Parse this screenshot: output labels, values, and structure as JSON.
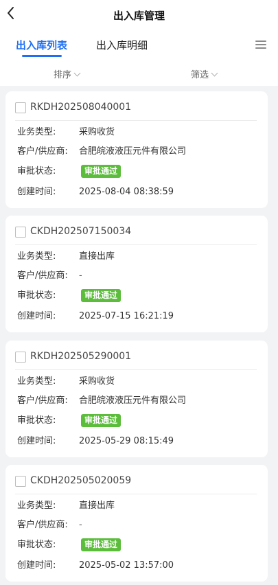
{
  "header": {
    "title": "出入库管理",
    "tabs": [
      {
        "label": "出入库列表",
        "active": true
      },
      {
        "label": "出入库明细",
        "active": false
      }
    ],
    "sort_label": "排序",
    "filter_label": "筛选"
  },
  "field_labels": {
    "business_type": "业务类型:",
    "customer_supplier": "客户/供应商:",
    "approval_status": "审批状态:",
    "created_time": "创建时间:"
  },
  "records": [
    {
      "order_no": "RKDH202508040001",
      "business_type": "采购收货",
      "customer_supplier": "合肥皖液液压元件有限公司",
      "approval_status": "审批通过",
      "created_time": "2025-08-04 08:38:59"
    },
    {
      "order_no": "CKDH202507150034",
      "business_type": "直接出库",
      "customer_supplier": "-",
      "approval_status": "审批通过",
      "created_time": "2025-07-15 16:21:19"
    },
    {
      "order_no": "RKDH202505290001",
      "business_type": "采购收货",
      "customer_supplier": "合肥皖液液压元件有限公司",
      "approval_status": "审批通过",
      "created_time": "2025-05-29 08:15:49"
    },
    {
      "order_no": "CKDH202505020059",
      "business_type": "直接出库",
      "customer_supplier": "-",
      "approval_status": "审批通过",
      "created_time": "2025-05-02 13:57:00"
    }
  ],
  "colors": {
    "accent": "#1e6ff5",
    "status_approved": "#5cbd3c",
    "background": "#f2f3f5"
  },
  "icons": [
    "back-arrow-icon",
    "menu-icon",
    "chevron-down-icon"
  ]
}
